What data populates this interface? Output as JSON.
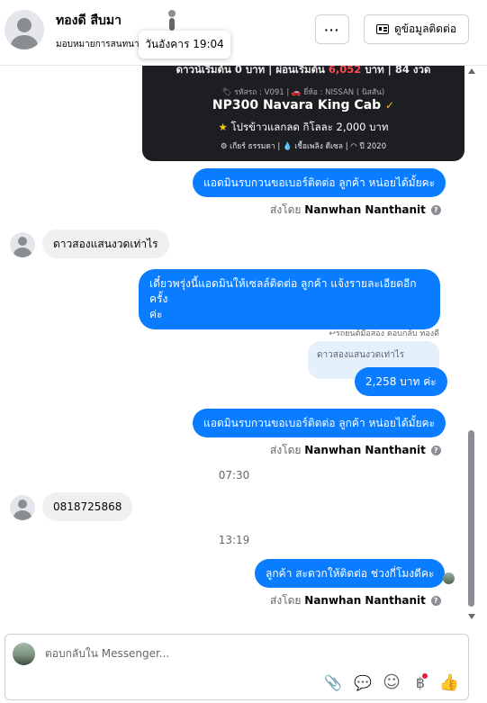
{
  "header": {
    "contact_name": "ทองดี สืบมา",
    "assigned_label": "มอบหมายการสนทนา",
    "tooltip": "วันอังคาร 19:04",
    "more_label": "···",
    "info_button_label": "ดูข้อมูลติดต่อ"
  },
  "card": {
    "line1_prefix": "ดาวน์เริ่มต้น 0 บาท | ผ่อนเริ่มต้น ",
    "line1_highlight": "6,052",
    "line1_suffix": " บาท | 84 งวด",
    "code_line": "🏷 รหัสรถ : V091 | 🚗 ยี่ห้อ : NISSAN ( นิสสัน)",
    "model": "NP300 Navara King Cab",
    "model_badge": "✓",
    "promo": "โปรข้าวแลกลด กิโลละ 2,000 บาท",
    "promo_star": "★",
    "specs": "⚙ เกียร์ ธรรมดา   |   💧 เชื้อเพลิง ดีเซล   |   ◠ ปี 2020"
  },
  "messages": {
    "m1": "แอดมินรบกวนขอเบอร์ติดต่อ ลูกค้า หน่อยได้มั้ยคะ",
    "sent_by_prefix": "ส่งโดย ",
    "sent_by_name": "Nanwhan Nanthanit",
    "info_icon": "?",
    "m2": "ดาวสองแสนงวดเท่าไร",
    "m3_line1": "เดี๋ยวพรุ่งนี้แอดมินให้เซลล์ติดต่อ ลูกค้า แจ้งรายละเอียดอีกครั้ง",
    "m3_line2": "ค่ะ",
    "reply_label": "↩รถยนต์มือสอง ตอบกลับ ทองดี",
    "reply_quote": "ดาวสองแสนงวดเท่าไร",
    "m4": "2,258 บาท ค่ะ",
    "m5": "แอดมินรบกวนขอเบอร์ติดต่อ ลูกค้า หน่อยได้มั้ยคะ",
    "time1": "07:30",
    "m6": "0818725868",
    "time2": "13:19",
    "m7": "ลูกค้า สะดวกให้ติดต่อ ช่วงกี่โมงดีคะ"
  },
  "composer": {
    "placeholder": "ตอบกลับใน Messenger...",
    "attach_icon": "📎",
    "saved_reply_icon": "💬",
    "emoji_icon": "☺",
    "payment_icon": "฿",
    "like_icon": "👍"
  },
  "colors": {
    "outgoing_bubble": "#0a7cff",
    "incoming_bubble": "#f0f0f0",
    "card_bg": "#1c1e21",
    "highlight_red": "#ff4d4d"
  }
}
